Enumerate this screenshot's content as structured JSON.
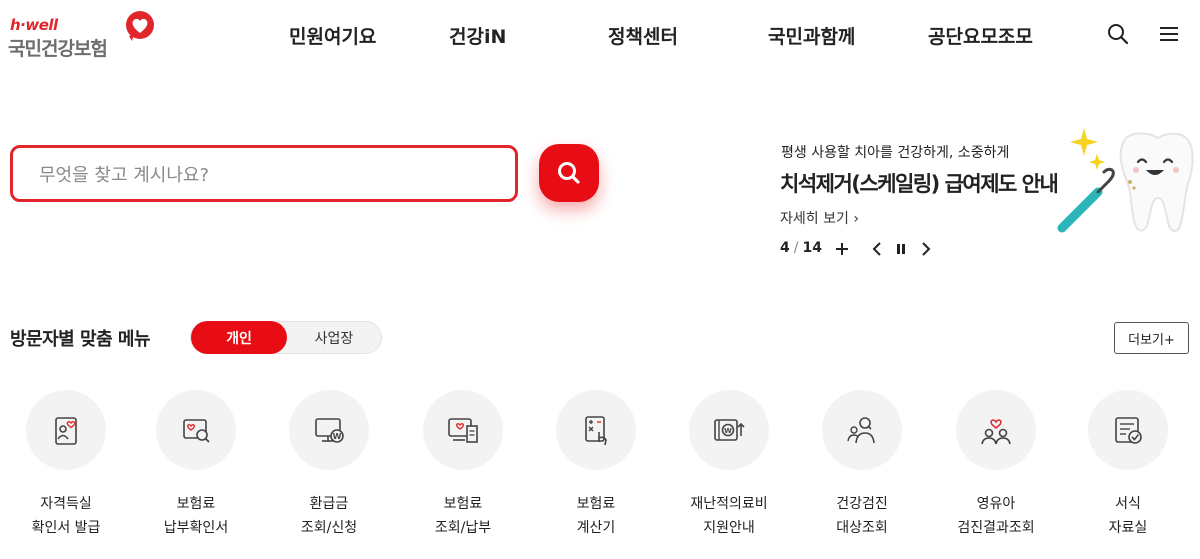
{
  "logo": {
    "tagline": "h·well",
    "name": "국민건강보험"
  },
  "nav": {
    "items": [
      "민원여기요",
      "건강iN",
      "정책센터",
      "국민과함께",
      "공단요모조모"
    ]
  },
  "header_icons": {
    "search": "search-icon",
    "menu": "hamburger-menu-icon"
  },
  "search": {
    "placeholder": "무엇을 찾고 계시나요?",
    "value": ""
  },
  "banner": {
    "subtitle": "평생 사용할 치아를 건강하게, 소중하게",
    "title": "치석제거(스케일링) 급여제도 안내",
    "more_label": "자세히 보기",
    "current": "4",
    "total": "14"
  },
  "section": {
    "title": "방문자별 맞춤 메뉴",
    "toggle": {
      "active": "개인",
      "inactive": "사업장"
    },
    "more_label": "더보기+"
  },
  "menu": [
    {
      "line1": "자격득실",
      "line2": "확인서 발급",
      "icon": "certificate-person-icon"
    },
    {
      "line1": "보험료",
      "line2": "납부확인서",
      "icon": "document-search-icon"
    },
    {
      "line1": "환급금",
      "line2": "조회/신청",
      "icon": "monitor-won-icon"
    },
    {
      "line1": "보험료",
      "line2": "조회/납부",
      "icon": "screen-receipt-icon"
    },
    {
      "line1": "보험료",
      "line2": "계산기",
      "icon": "calculator-hand-icon"
    },
    {
      "line1": "재난적의료비",
      "line2": "지원안내",
      "icon": "wallet-won-icon"
    },
    {
      "line1": "건강검진",
      "line2": "대상조회",
      "icon": "people-search-icon"
    },
    {
      "line1": "영유아",
      "line2": "검진결과조회",
      "icon": "family-heart-icon"
    },
    {
      "line1": "서식",
      "line2": "자료실",
      "icon": "form-check-icon"
    }
  ],
  "colors": {
    "accent": "#e80d15",
    "text": "#222222",
    "icon_bg": "#f3f3f3"
  }
}
